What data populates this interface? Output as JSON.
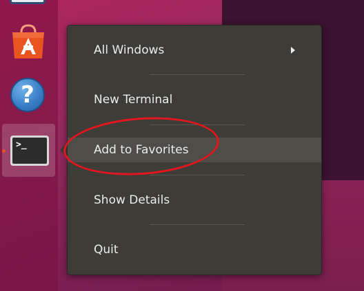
{
  "dock": {
    "items": [
      {
        "name": "Files"
      },
      {
        "name": "Ubuntu Software"
      },
      {
        "name": "Help"
      },
      {
        "name": "Terminal",
        "running": true,
        "terminal_glyph": ">_"
      }
    ]
  },
  "help_icon": {
    "glyph": "?"
  },
  "context_menu": {
    "items": [
      {
        "label": "All Windows",
        "has_submenu": true
      },
      {
        "label": "New Terminal"
      },
      {
        "label": "Add to Favorites",
        "highlighted": true
      },
      {
        "label": "Show Details"
      },
      {
        "label": "Quit"
      }
    ]
  },
  "colors": {
    "menu_bg": "#3d3c37",
    "menu_hover": "#4e4d48",
    "annotation": "#e2161f",
    "running_indicator": "#e95420"
  }
}
